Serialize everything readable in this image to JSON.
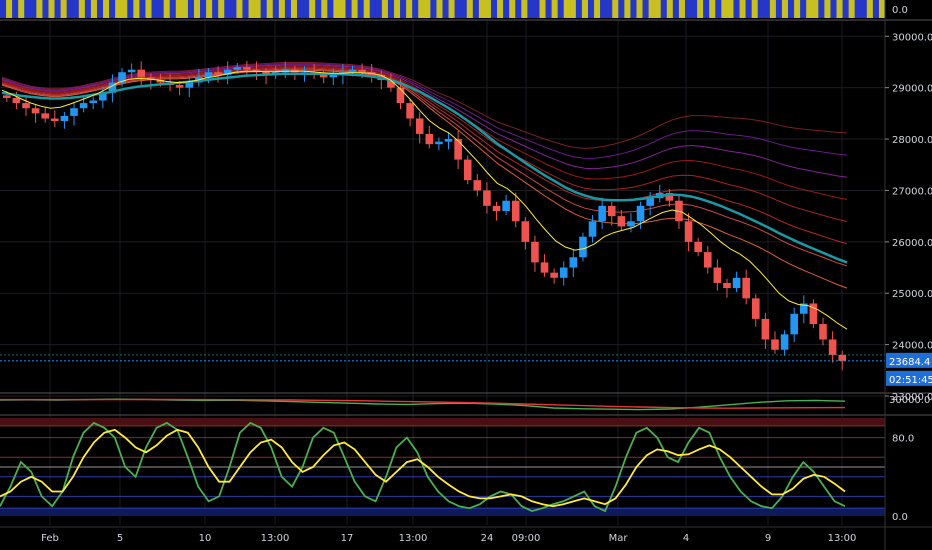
{
  "chart_data": [
    {
      "type": "heatmap",
      "pane": "top-strip",
      "label": "0.0",
      "colors": {
        "a": "#2537c8",
        "b": "#c8c020"
      },
      "pattern": [
        0,
        1,
        0,
        1,
        0,
        0,
        1,
        0,
        1,
        0,
        1,
        0,
        0,
        1,
        0,
        1,
        0,
        1,
        0,
        1,
        1,
        0,
        1,
        0,
        1,
        0,
        0,
        1,
        0,
        1,
        1,
        0,
        1,
        0,
        1,
        0,
        1,
        0,
        0,
        1,
        0,
        1,
        1,
        0,
        1,
        0,
        1,
        0,
        1,
        0,
        0,
        1,
        0,
        1,
        0,
        1,
        1,
        0,
        1,
        0,
        1,
        0,
        0,
        1,
        0,
        1,
        0,
        1,
        0,
        1,
        1,
        0,
        1,
        0,
        1,
        0,
        0,
        1,
        0,
        1,
        1,
        0,
        1,
        0,
        1,
        0,
        1,
        0,
        0,
        1,
        0,
        1,
        0,
        1,
        1,
        0,
        1,
        0,
        1,
        0,
        0,
        1,
        0,
        1,
        0,
        1,
        0,
        1,
        1,
        0,
        1,
        0,
        1,
        0,
        0,
        1,
        0,
        1,
        0,
        1,
        1,
        0,
        1,
        0,
        1,
        0,
        0,
        1,
        0,
        1,
        0,
        1,
        0,
        1,
        1,
        0,
        1,
        0,
        1,
        0,
        1,
        0,
        0,
        1,
        0,
        1
      ]
    },
    {
      "type": "line",
      "pane": "price",
      "ylim": [
        23000,
        30200
      ],
      "y_ticks": [
        "30000.0",
        "29000.0",
        "28000.0",
        "27000.0",
        "26000.0",
        "25000.0",
        "24000.0",
        "23000.0"
      ],
      "x_ticks": [
        "Feb",
        "5",
        "10",
        "13:00",
        "17",
        "13:00",
        "24",
        "09:00",
        "Mar",
        "4",
        "9",
        "13:00"
      ],
      "candles_approx": [
        28800,
        28700,
        28600,
        28500,
        28400,
        28350,
        28450,
        28600,
        28700,
        28750,
        28900,
        29100,
        29300,
        29350,
        29200,
        29150,
        29100,
        29050,
        29000,
        29100,
        29200,
        29300,
        29250,
        29350,
        29400,
        29350,
        29300,
        29250,
        29300,
        29350,
        29300,
        29300,
        29250,
        29200,
        29250,
        29300,
        29350,
        29300,
        29250,
        29150,
        29000,
        28700,
        28400,
        28100,
        27900,
        27950,
        28000,
        27600,
        27200,
        27000,
        26700,
        26600,
        26800,
        26400,
        26000,
        25600,
        25400,
        25300,
        25500,
        25700,
        26100,
        26400,
        26700,
        26500,
        26300,
        26400,
        26700,
        26850,
        26950,
        26800,
        26400,
        26000,
        25800,
        25500,
        25200,
        25100,
        25300,
        24900,
        24500,
        24100,
        23900,
        24200,
        24600,
        24800,
        24400,
        24100,
        23800,
        23684
      ],
      "ema_fast": [
        28950,
        28870,
        28780,
        28700,
        28640,
        28600,
        28620,
        28680,
        28750,
        28820,
        28900,
        29000,
        29100,
        29160,
        29180,
        29170,
        29150,
        29120,
        29100,
        29110,
        29140,
        29190,
        29220,
        29260,
        29300,
        29320,
        29320,
        29310,
        29310,
        29320,
        29320,
        29320,
        29310,
        29290,
        29280,
        29280,
        29290,
        29290,
        29280,
        29240,
        29150,
        28980,
        28780,
        28560,
        28360,
        28220,
        28120,
        27960,
        27760,
        27560,
        27340,
        27140,
        27040,
        26880,
        26680,
        26440,
        26220,
        26020,
        25900,
        25840,
        25870,
        25960,
        26100,
        26180,
        26230,
        26280,
        26380,
        26480,
        26570,
        26620,
        26580,
        26460,
        26330,
        26170,
        26000,
        25860,
        25760,
        25620,
        25430,
        25220,
        25000,
        24850,
        24780,
        24760,
        24680,
        24560,
        24420,
        24300
      ],
      "ribbon_count": 8,
      "ribbon_base": [
        29050,
        28990,
        28930,
        28880,
        28850,
        28830,
        28830,
        28850,
        28880,
        28920,
        28960,
        29010,
        29060,
        29100,
        29130,
        29150,
        29160,
        29170,
        29170,
        29180,
        29200,
        29220,
        29240,
        29260,
        29280,
        29300,
        29310,
        29320,
        29330,
        29340,
        29340,
        29340,
        29340,
        29330,
        29320,
        29310,
        29300,
        29280,
        29250,
        29210,
        29150,
        29050,
        28920,
        28770,
        28610,
        28460,
        28320,
        28170,
        28010,
        27850,
        27690,
        27530,
        27400,
        27270,
        27140,
        27010,
        26880,
        26760,
        26640,
        26540,
        26460,
        26410,
        26380,
        26360,
        26350,
        26350,
        26370,
        26400,
        26440,
        26460,
        26450,
        26420,
        26360,
        26290,
        26210,
        26130,
        26060,
        25980,
        25890,
        25790,
        25680,
        25580,
        25490,
        25410,
        25330,
        25250,
        25170,
        25100
      ],
      "ema_slow": [
        28900,
        28870,
        28840,
        28820,
        28800,
        28790,
        28790,
        28800,
        28820,
        28850,
        28880,
        28910,
        28950,
        28990,
        29020,
        29040,
        29060,
        29080,
        29090,
        29110,
        29130,
        29150,
        29170,
        29190,
        29210,
        29230,
        29240,
        29250,
        29260,
        29270,
        29270,
        29270,
        29270,
        29270,
        29270,
        29260,
        29250,
        29240,
        29220,
        29190,
        29150,
        29090,
        29010,
        28920,
        28820,
        28710,
        28600,
        28480,
        28350,
        28210,
        28060,
        27910,
        27780,
        27650,
        27520,
        27400,
        27280,
        27170,
        27060,
        26970,
        26900,
        26850,
        26820,
        26810,
        26810,
        26820,
        26840,
        26870,
        26900,
        26920,
        26910,
        26880,
        26830,
        26770,
        26700,
        26620,
        26540,
        26450,
        26360,
        26270,
        26170,
        26080,
        25990,
        25910,
        25830,
        25750,
        25670,
        25600
      ],
      "last_price": 23684.4,
      "last_price_label": "23684.4",
      "countdown_label": "02:51:45",
      "colors": {
        "up": "#2196f3",
        "down": "#ef5350",
        "ema_fast": "#ffeb3b",
        "ema_slow": "#1a9aa4",
        "tag": "#1e6fd9"
      }
    },
    {
      "type": "line",
      "pane": "indicator",
      "y_tick": "30000.0",
      "series": [
        {
          "color": "#4caf50",
          "values": [
            0.5,
            0.52,
            0.5,
            0.55,
            0.6,
            0.58,
            0.5,
            0.45,
            0.48,
            0.4,
            0.3,
            0.2,
            0.1,
            0.0,
            -0.05,
            0.05,
            0.1,
            0.0,
            -0.2,
            -0.5,
            -0.6,
            -0.65,
            -0.7,
            -0.62,
            -0.4,
            -0.1,
            0.2,
            0.4,
            0.45,
            0.35
          ]
        },
        {
          "color": "#e53935",
          "values": [
            0.55,
            0.55,
            0.55,
            0.55,
            0.55,
            0.56,
            0.56,
            0.55,
            0.54,
            0.52,
            0.5,
            0.46,
            0.42,
            0.36,
            0.3,
            0.24,
            0.18,
            0.1,
            0.0,
            -0.1,
            -0.2,
            -0.3,
            -0.38,
            -0.45,
            -0.5,
            -0.52,
            -0.5,
            -0.48,
            -0.46,
            -0.45
          ]
        }
      ]
    },
    {
      "type": "line",
      "pane": "stoch",
      "ylim": [
        0,
        100
      ],
      "y_ticks": [
        "80.0",
        "0.0"
      ],
      "series": [
        {
          "color": "#4caf50",
          "values": [
            10,
            30,
            55,
            45,
            20,
            10,
            25,
            60,
            85,
            95,
            90,
            80,
            50,
            40,
            70,
            90,
            95,
            88,
            60,
            30,
            15,
            20,
            50,
            85,
            95,
            90,
            70,
            40,
            30,
            50,
            80,
            90,
            85,
            60,
            35,
            20,
            15,
            40,
            70,
            80,
            65,
            40,
            25,
            15,
            10,
            8,
            12,
            20,
            25,
            22,
            10,
            5,
            8,
            12,
            15,
            20,
            25,
            10,
            5,
            30,
            60,
            85,
            90,
            80,
            60,
            55,
            75,
            90,
            85,
            60,
            40,
            25,
            15,
            10,
            8,
            20,
            40,
            55,
            45,
            30,
            15,
            10
          ]
        },
        {
          "color": "#ffeb3b",
          "values": [
            20,
            25,
            35,
            40,
            35,
            25,
            25,
            40,
            60,
            75,
            85,
            88,
            80,
            70,
            65,
            72,
            82,
            88,
            85,
            70,
            50,
            35,
            35,
            50,
            65,
            75,
            78,
            70,
            55,
            45,
            50,
            62,
            72,
            75,
            68,
            55,
            42,
            35,
            45,
            55,
            58,
            50,
            40,
            32,
            25,
            20,
            18,
            18,
            20,
            22,
            20,
            15,
            12,
            10,
            12,
            15,
            18,
            15,
            12,
            18,
            32,
            50,
            62,
            68,
            66,
            62,
            63,
            68,
            72,
            68,
            60,
            50,
            40,
            30,
            22,
            22,
            28,
            38,
            42,
            40,
            33,
            25
          ]
        }
      ]
    }
  ]
}
